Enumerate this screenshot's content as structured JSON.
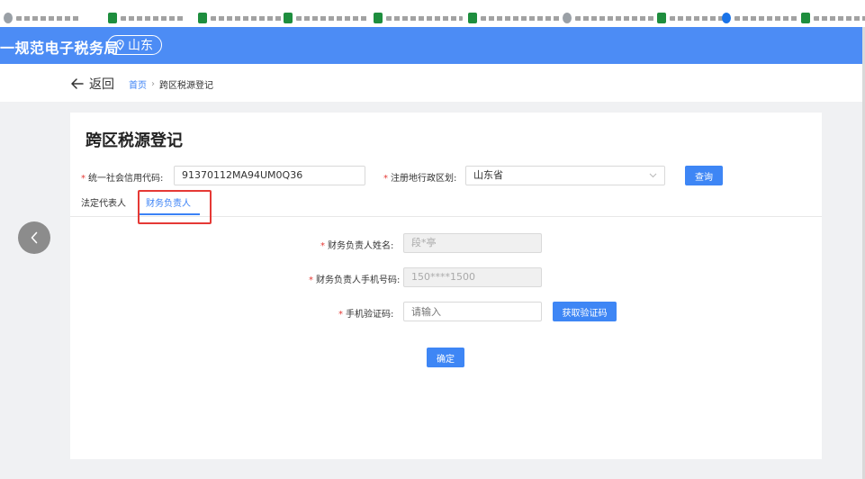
{
  "header": {
    "brand": "一规范电子税务局",
    "region": "山东"
  },
  "nav": {
    "back_label": "返回",
    "breadcrumb": [
      "首页",
      "跨区税源登记"
    ]
  },
  "form": {
    "title": "跨区税源登记",
    "credit_code": {
      "label": "统一社会信用代码:",
      "value": "91370112MA94UM0Q36"
    },
    "region_select": {
      "label": "注册地行政区划:",
      "value": "山东省"
    },
    "query_button": "查询"
  },
  "tabs": [
    {
      "label": "法定代表人",
      "active": false
    },
    {
      "label": "财务负责人",
      "active": true
    }
  ],
  "finance_form": {
    "name": {
      "label": "财务负责人姓名:",
      "value": "段*亭"
    },
    "phone": {
      "label": "财务负责人手机号码:",
      "value": "150****1500"
    },
    "code": {
      "label": "手机验证码:",
      "placeholder": "请输入"
    },
    "get_code_button": "获取验证码",
    "confirm_button": "确定"
  },
  "colors": {
    "header_blue": "#4c8cf5",
    "primary": "#3e86f5",
    "required": "#e53935",
    "annotation": "#e53935"
  }
}
